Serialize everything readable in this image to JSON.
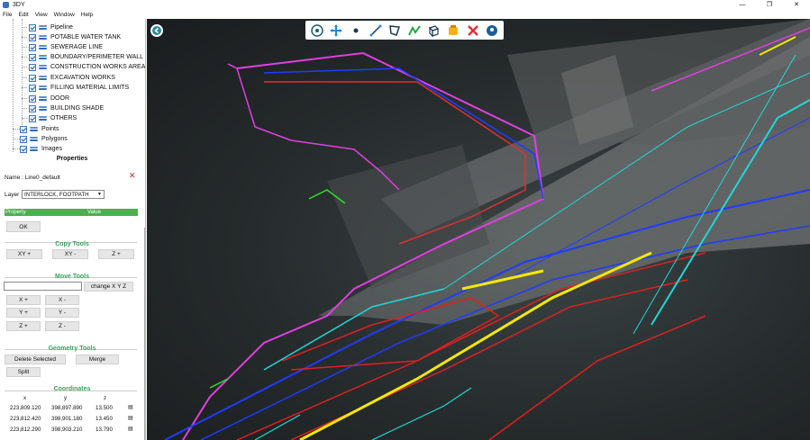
{
  "window": {
    "title": "3DY",
    "controls": [
      "—",
      "❐",
      "✕"
    ]
  },
  "menu": [
    "File",
    "Edit",
    "View",
    "Window",
    "Help"
  ],
  "layers": {
    "items": [
      "Pipeline",
      "POTABLE WATER TANK",
      "SEWERAGE LINE",
      "BOUNDARY/PERIMETER WALL",
      "CONSTRUCTION WORKS AREA",
      "EXCAVATION WORKS",
      "FILLING MATERIAL LIMITS",
      "DOOR",
      "BUILDING SHADE",
      "OTHERS"
    ],
    "root_items": [
      "Points",
      "Polygons",
      "Images"
    ]
  },
  "properties": {
    "title": "Properties",
    "name_text": "Name : Line0_default",
    "layer_label": "Layer :",
    "layer_value": "INTERLOCK, FOOTPATH",
    "col_property": "Property",
    "col_value": "Value",
    "ok_label": "OK"
  },
  "copy_tools": {
    "title": "Copy Tools",
    "buttons": [
      "XY +",
      "XY -",
      "Z +"
    ]
  },
  "move_tools": {
    "title": "Move Tools",
    "change_label": "change X Y Z",
    "buttons": [
      "X +",
      "X -",
      "Y +",
      "Y -",
      "Z +",
      "Z -"
    ]
  },
  "geometry_tools": {
    "title": "Geometry Tools",
    "delete_label": "Delete Selected",
    "merge_label": "Merge",
    "split_label": "Split"
  },
  "coordinates": {
    "title": "Coordinates",
    "headers": [
      "x",
      "y",
      "z"
    ],
    "rows": [
      [
        "223,809.120",
        "398,897.890",
        "13.500"
      ],
      [
        "223,812.420",
        "398,901.180",
        "13.450"
      ],
      [
        "223,812.290",
        "398,903.210",
        "13.790"
      ]
    ]
  },
  "colors": {
    "accent_green": "#3aa35a",
    "header_green": "#4caf50",
    "viewport_bg": "#252a2b"
  },
  "toolbar_icons": [
    "compass-icon",
    "pan-icon",
    "point-icon",
    "line-icon",
    "polygon-icon",
    "profile-icon",
    "cube-icon",
    "bucket-icon",
    "delete-icon",
    "location-icon"
  ]
}
